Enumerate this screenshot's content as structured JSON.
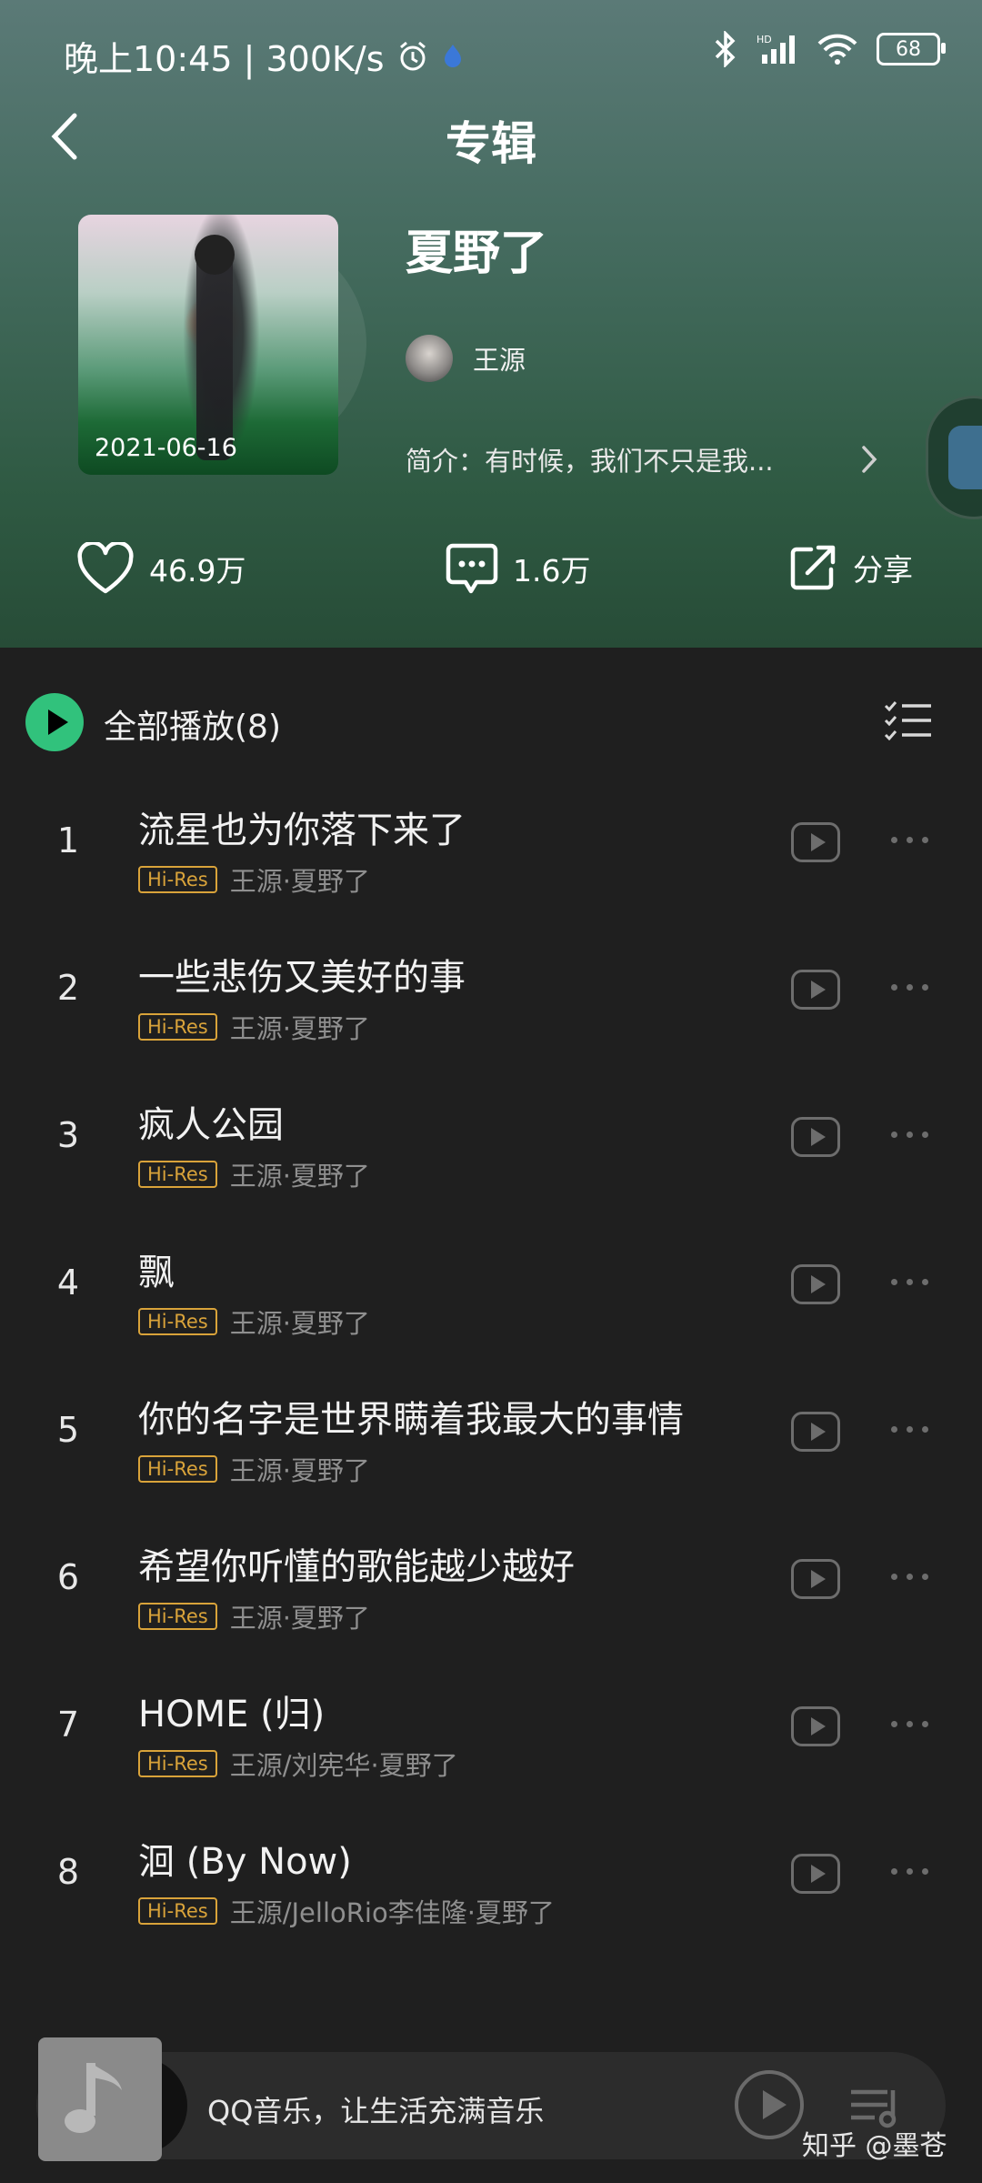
{
  "status_bar": {
    "time": "晚上10:45 | 300K/s",
    "battery": "68"
  },
  "header": {
    "title": "专辑"
  },
  "album": {
    "title": "夏野了",
    "release_date": "2021-06-16",
    "artist": "王源",
    "intro": "简介：有时候，我们不只是我..."
  },
  "actions": {
    "likes": "46.9万",
    "comments": "1.6万",
    "share": "分享"
  },
  "play_all": {
    "label": "全部播放(8)"
  },
  "songs": [
    {
      "index": "1",
      "title": "流星也为你落下来了",
      "badge": "Hi-Res",
      "artist_album": "王源·夏野了"
    },
    {
      "index": "2",
      "title": "一些悲伤又美好的事",
      "badge": "Hi-Res",
      "artist_album": "王源·夏野了"
    },
    {
      "index": "3",
      "title": "疯人公园",
      "badge": "Hi-Res",
      "artist_album": "王源·夏野了"
    },
    {
      "index": "4",
      "title": "飘",
      "badge": "Hi-Res",
      "artist_album": "王源·夏野了"
    },
    {
      "index": "5",
      "title": "你的名字是世界瞒着我最大的事情",
      "badge": "Hi-Res",
      "artist_album": "王源·夏野了"
    },
    {
      "index": "6",
      "title": "希望你听懂的歌能越少越好",
      "badge": "Hi-Res",
      "artist_album": "王源·夏野了"
    },
    {
      "index": "7",
      "title": "HOME (归)",
      "badge": "Hi-Res",
      "artist_album": "王源/刘宪华·夏野了"
    },
    {
      "index": "8",
      "title": "洄 (By Now)",
      "badge": "Hi-Res",
      "artist_album": "王源/JelloRio李佳隆·夏野了"
    }
  ],
  "player": {
    "text": "QQ音乐，让生活充满音乐"
  },
  "watermark": "知乎 @墨苍",
  "colors": {
    "accent": "#31c27c",
    "hires_badge": "#d9a33a",
    "background": "#1f1f1f"
  }
}
